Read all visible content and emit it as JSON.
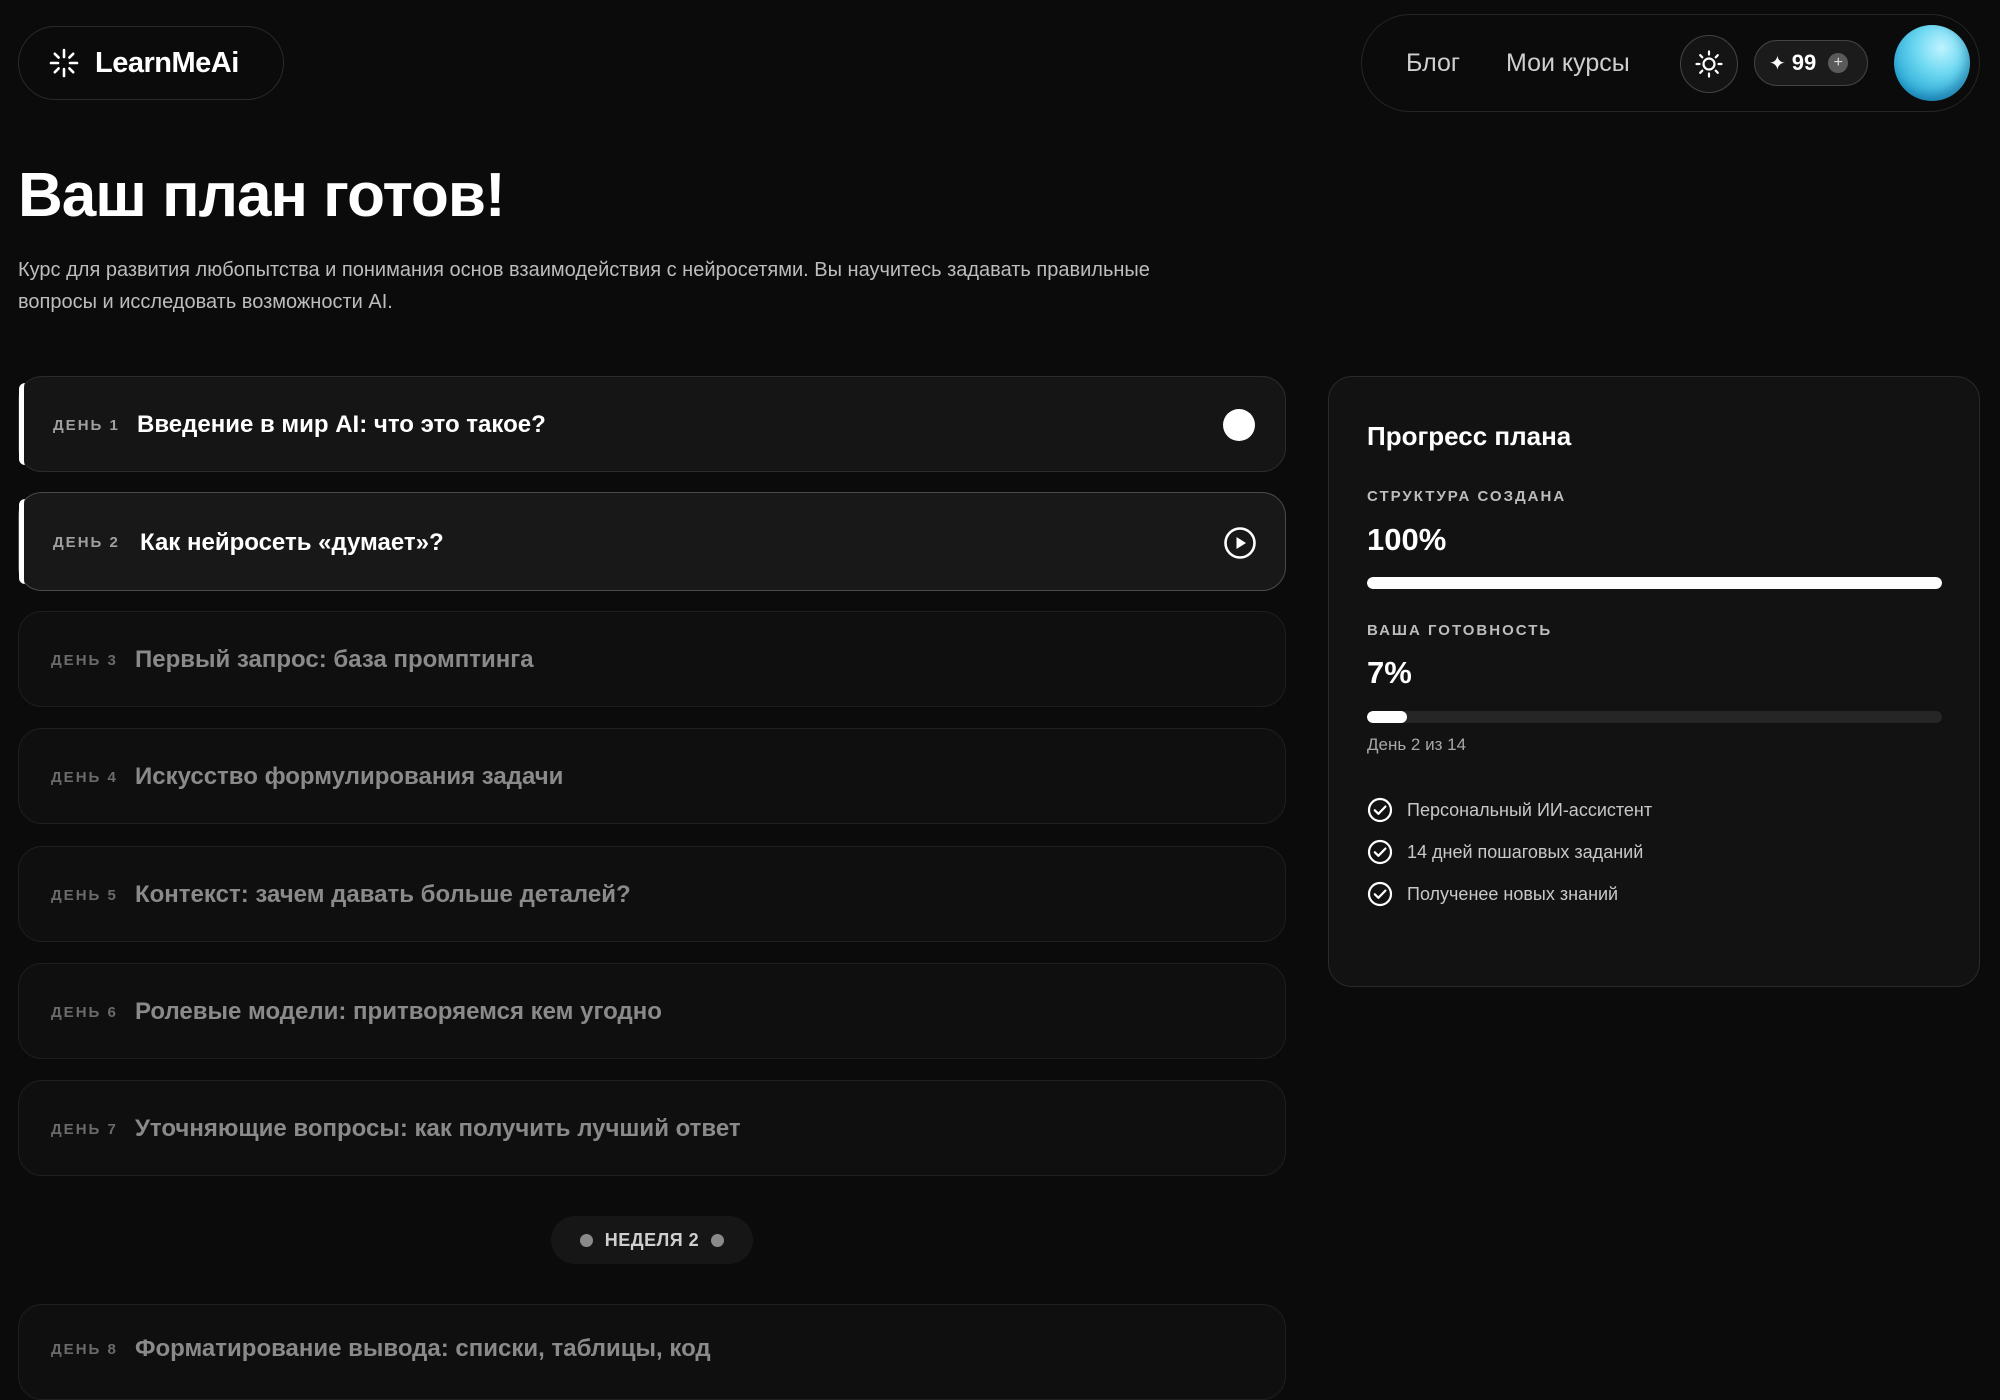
{
  "header": {
    "logo_text": "LearnMeAi",
    "nav": [
      {
        "label": "Блог"
      },
      {
        "label": "Мои курсы"
      }
    ],
    "credits": {
      "star": "✦",
      "count": "99",
      "plus": "+"
    }
  },
  "hero": {
    "title": "Ваш план готов!",
    "description": "Курс для развития любопытства и понимания основ взаимодействия с нейросетями. Вы научитесь задавать правильные вопросы и исследовать возможности AI."
  },
  "days": [
    {
      "day": "ДЕНЬ 1",
      "title": "Введение в мир AI: что это такое?",
      "state": "done"
    },
    {
      "day": "ДЕНЬ 2",
      "title": "Как нейросеть «думает»?",
      "state": "current"
    },
    {
      "day": "ДЕНЬ 3",
      "title": "Первый запрос: база промптинга",
      "state": "locked"
    },
    {
      "day": "ДЕНЬ 4",
      "title": "Искусство формулирования задачи",
      "state": "locked"
    },
    {
      "day": "ДЕНЬ 5",
      "title": "Контекст: зачем давать больше деталей?",
      "state": "locked"
    },
    {
      "day": "ДЕНЬ 6",
      "title": "Ролевые модели: притворяемся кем угодно",
      "state": "locked"
    },
    {
      "day": "ДЕНЬ 7",
      "title": "Уточняющие вопросы: как получить лучший ответ",
      "state": "locked"
    },
    {
      "day": "ДЕНЬ 8",
      "title": "Форматирование вывода: списки, таблицы, код",
      "state": "locked"
    }
  ],
  "week_divider": {
    "label": "НЕДЕЛЯ 2"
  },
  "progress": {
    "title": "Прогресс плана",
    "structure_label": "СТРУКТУРА СОЗДАНА",
    "structure_value": "100%",
    "structure_fraction": 1.0,
    "readiness_label": "ВАША ГОТОВНОСТЬ",
    "readiness_value": "7%",
    "readiness_fraction": 0.07,
    "day_counter": "День 2 из 14",
    "features": [
      {
        "label": "Персональный ИИ-ассистент"
      },
      {
        "label": "14 дней пошаговых заданий"
      },
      {
        "label": "Полученее новых знаний"
      }
    ]
  },
  "colors": {
    "background": "#0b0b0b",
    "accent": "#ffffff",
    "avatar": "#6fd9f2"
  }
}
